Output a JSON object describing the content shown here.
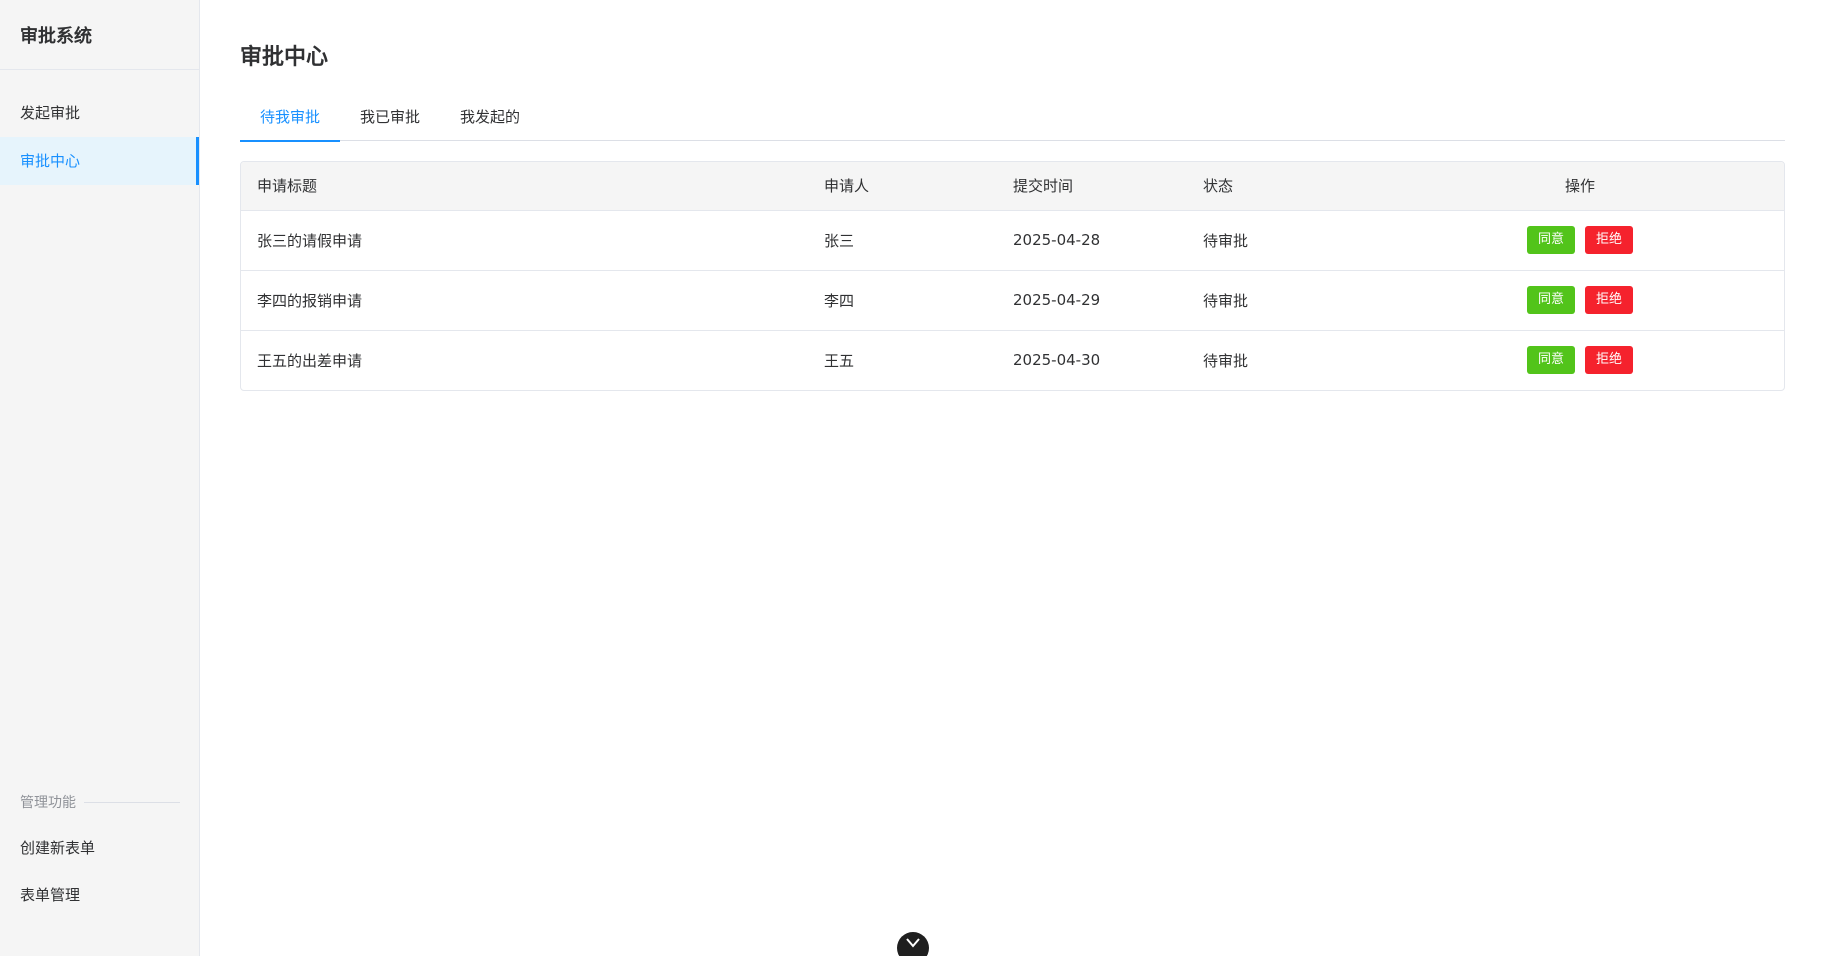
{
  "sidebar": {
    "title": "审批系统",
    "nav": [
      {
        "label": "发起审批",
        "active": false
      },
      {
        "label": "审批中心",
        "active": true
      }
    ],
    "admin": {
      "heading": "管理功能",
      "items": [
        {
          "label": "创建新表单"
        },
        {
          "label": "表单管理"
        }
      ]
    }
  },
  "main": {
    "title": "审批中心",
    "tabs": [
      {
        "label": "待我审批",
        "active": true
      },
      {
        "label": "我已审批",
        "active": false
      },
      {
        "label": "我发起的",
        "active": false
      }
    ],
    "table": {
      "columns": [
        "申请标题",
        "申请人",
        "提交时间",
        "状态",
        "操作"
      ],
      "rows": [
        {
          "title": "张三的请假申请",
          "applicant": "张三",
          "time": "2025-04-28",
          "status": "待审批"
        },
        {
          "title": "李四的报销申请",
          "applicant": "李四",
          "time": "2025-04-29",
          "status": "待审批"
        },
        {
          "title": "王五的出差申请",
          "applicant": "王五",
          "time": "2025-04-30",
          "status": "待审批"
        }
      ],
      "approve_label": "同意",
      "reject_label": "拒绝"
    }
  },
  "colors": {
    "accent": "#1890ff",
    "approve": "#52c41a",
    "reject": "#f5222d"
  },
  "icons": {
    "floating_toggle": "chevron-down-icon"
  }
}
